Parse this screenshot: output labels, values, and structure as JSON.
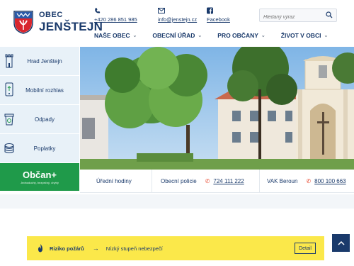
{
  "header": {
    "logo_small": "OBEC",
    "logo_big": "JENŠTEJN",
    "phone": "+420 286 851 985",
    "email": "info@jenstejn.cz",
    "facebook": "Facebook",
    "search_placeholder": "Hledaný výraz"
  },
  "nav": [
    {
      "label": "NAŠE OBEC"
    },
    {
      "label": "OBECNÍ ÚŘAD"
    },
    {
      "label": "PRO OBČANY"
    },
    {
      "label": "ŽIVOT V OBCI"
    }
  ],
  "sidebar": {
    "items": [
      {
        "label": "Hrad Jenštejn",
        "icon": "tower-icon"
      },
      {
        "label": "Mobilní rozhlas",
        "icon": "phone-icon"
      },
      {
        "label": "Odpady",
        "icon": "bin-icon"
      },
      {
        "label": "Poplatky",
        "icon": "coins-icon"
      }
    ],
    "obcan_title": "Občan+",
    "obcan_sub": "Jednoduchý, bezpečný, chytrý"
  },
  "infobar": {
    "hours": "Úřední hodiny",
    "police_label": "Obecní policie",
    "police_phone": "724 111 222",
    "vak_label": "VAK Beroun",
    "vak_phone": "800 100 663"
  },
  "alert": {
    "title": "Riziko požárů",
    "text": "Nízký stupeň nebezpečí",
    "detail": "Detail"
  },
  "colors": {
    "primary": "#1a3a6b",
    "sidebar_bg": "#e8f1f8",
    "obcan_green": "#1f9a4a",
    "alert_yellow": "#fbe84a",
    "phone_red": "#e8442a"
  }
}
